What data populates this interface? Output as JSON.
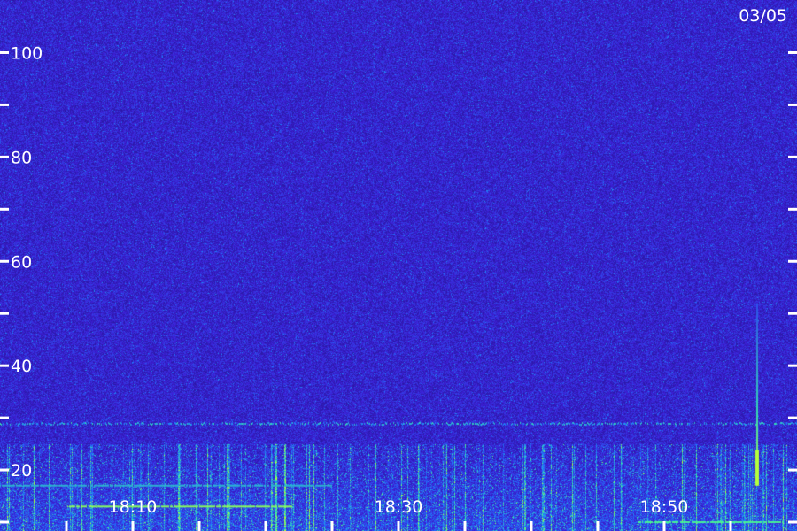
{
  "chart_data": {
    "type": "heatmap",
    "date_label": "03/05",
    "y_ticks": [
      {
        "value": 100,
        "label": "100"
      },
      {
        "value": 80,
        "label": "80"
      },
      {
        "value": 60,
        "label": "60"
      },
      {
        "value": 40,
        "label": "40"
      },
      {
        "value": 20,
        "label": "20"
      }
    ],
    "y_minor_ticks": [
      90,
      70,
      50,
      30,
      10
    ],
    "ylim": [
      10,
      105
    ],
    "x_ticks": [
      {
        "value": "18:10",
        "label": "18:10"
      },
      {
        "value": "18:30",
        "label": "18:30"
      },
      {
        "value": "18:50",
        "label": "18:50"
      }
    ],
    "x_tick_marks": [
      "18:05",
      "18:10",
      "18:15",
      "18:20",
      "18:25",
      "18:30",
      "18:35",
      "18:40",
      "18:45",
      "18:50",
      "18:55"
    ],
    "xlim": [
      "18:00",
      "18:60"
    ],
    "features": [
      {
        "kind": "band",
        "y": 29,
        "intensity": 0.6
      },
      {
        "kind": "line",
        "y": 13,
        "from": "18:05",
        "to": "18:22",
        "intensity": 0.9
      },
      {
        "kind": "line",
        "y": 17,
        "from": "18:00",
        "to": "18:25",
        "intensity": 0.55
      },
      {
        "kind": "line",
        "y": 10,
        "from": "18:48",
        "to": "18:59",
        "intensity": 0.75
      },
      {
        "kind": "spike",
        "x": "18:57",
        "y_from": 17,
        "y_to": 52,
        "intensity": 1.0
      }
    ],
    "colors": {
      "background": "#14106e",
      "low": "#3d1fd6",
      "mid": "#1e7bff",
      "high": "#3cf0a0",
      "peak": "#b4ff3c",
      "text": "#ffffff"
    }
  }
}
